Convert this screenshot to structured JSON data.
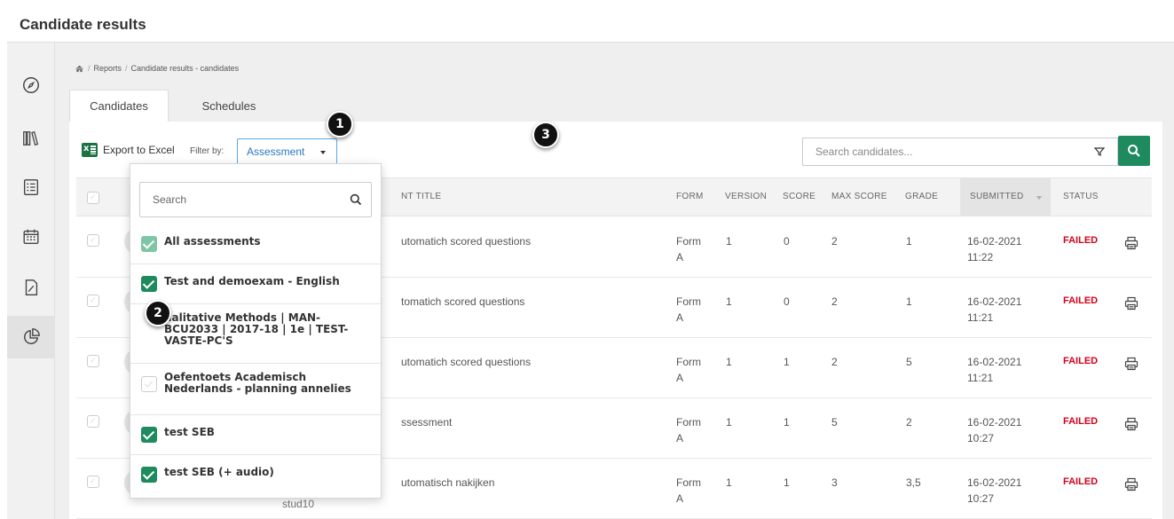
{
  "page": {
    "title": "Candidate results"
  },
  "breadcrumb": {
    "home_icon": "home-icon",
    "items": [
      "Reports",
      "Candidate results - candidates"
    ],
    "separator": "/"
  },
  "tabs": [
    {
      "label": "Candidates",
      "active": true
    },
    {
      "label": "Schedules",
      "active": false
    }
  ],
  "sidebar": {
    "items": [
      "compass-icon",
      "library-icon",
      "list-icon",
      "calendar-icon",
      "document-icon",
      "chart-pie-icon"
    ],
    "active_index": 5
  },
  "toolbar": {
    "export_label": "Export to Excel",
    "filter_label": "Filter by:",
    "filter_value": "Assessment",
    "search_placeholder": "Search candidates...",
    "accent_color": "#1e8a5e"
  },
  "table": {
    "columns": [
      "NT TITLE",
      "FORM",
      "VERSION",
      "SCORE",
      "MAX SCORE",
      "GRADE",
      "SUBMITTED",
      "STATUS"
    ],
    "rows": [
      {
        "title": "utomatich scored questions",
        "form": "Form",
        "form_sub": "A",
        "version": "1",
        "score": "0",
        "max_score": "2",
        "grade": "1",
        "date": "16-02-2021",
        "time": "11:22",
        "status": "FAILED"
      },
      {
        "title": "tomatich scored questions",
        "form": "Form",
        "form_sub": "A",
        "version": "1",
        "score": "0",
        "max_score": "2",
        "grade": "1",
        "date": "16-02-2021",
        "time": "11:21",
        "status": "FAILED"
      },
      {
        "title": "utomatich scored questions",
        "form": "Form",
        "form_sub": "A",
        "version": "1",
        "score": "1",
        "max_score": "2",
        "grade": "5",
        "date": "16-02-2021",
        "time": "11:21",
        "status": "FAILED"
      },
      {
        "title": "ssessment",
        "form": "Form",
        "form_sub": "A",
        "version": "1",
        "score": "1",
        "max_score": "5",
        "grade": "2",
        "date": "16-02-2021",
        "time": "10:27",
        "status": "FAILED"
      },
      {
        "title": "utomatisch nakijken",
        "form": "Form",
        "form_sub": "A",
        "version": "1",
        "score": "1",
        "max_score": "3",
        "grade": "3,5",
        "date": "16-02-2021",
        "time": "10:27",
        "status": "FAILED",
        "extra": "stud10"
      }
    ]
  },
  "dropdown": {
    "search_placeholder": "Search",
    "options": [
      {
        "label_lines": [
          "All assessments"
        ],
        "state": "light"
      },
      {
        "label_lines": [
          "Test and demoexam - English"
        ],
        "state": "on"
      },
      {
        "label_lines": [
          "ualitative Methods | MAN-",
          "BCU2033 | 2017-18 | 1e | TEST-",
          "VASTE-PC'S"
        ],
        "state": "hidden"
      },
      {
        "label_lines": [
          "Oefentoets Academisch",
          "Nederlands - planning annelies"
        ],
        "state": "off"
      },
      {
        "label_lines": [
          "test SEB"
        ],
        "state": "on"
      },
      {
        "label_lines": [
          "test SEB (+ audio)"
        ],
        "state": "on"
      }
    ]
  },
  "callouts": [
    "1",
    "2",
    "3"
  ]
}
